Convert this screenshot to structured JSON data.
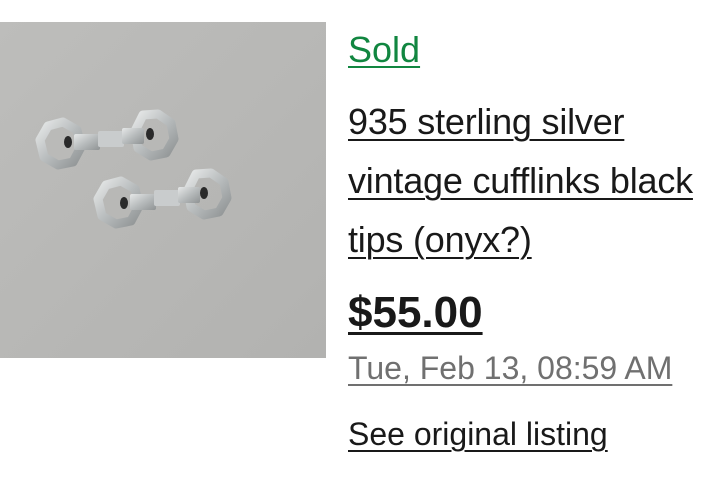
{
  "listing": {
    "status": "Sold",
    "title": "935 sterling silver vintage cufflinks black tips (onyx?)",
    "price": "$55.00",
    "sold_date": "Tue, Feb 13, 08:59 AM",
    "see_original_label": "See original listing"
  },
  "colors": {
    "status_green": "#118640",
    "text": "#191919",
    "muted": "#707070",
    "photo_bg": "#b9b9b7"
  }
}
